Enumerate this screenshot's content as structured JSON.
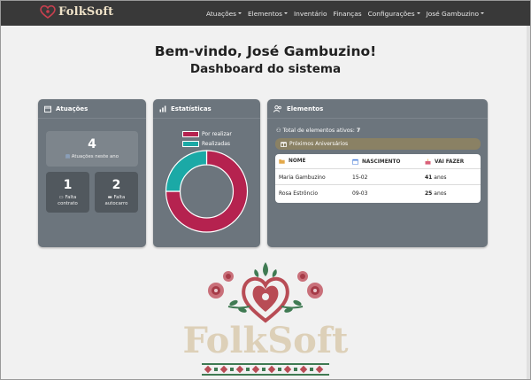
{
  "navbar": {
    "brand": "FolkSoft",
    "items": [
      {
        "label": "Atuações",
        "dropdown": true
      },
      {
        "label": "Elementos",
        "dropdown": true
      },
      {
        "label": "Inventário",
        "dropdown": false
      },
      {
        "label": "Finanças",
        "dropdown": false
      },
      {
        "label": "Configurações",
        "dropdown": true
      },
      {
        "label": "José Gambuzino",
        "dropdown": true
      }
    ]
  },
  "header": {
    "welcome": "Bem-vindo, José Gambuzino!",
    "subtitle": "Dashboard do sistema"
  },
  "atuacoes_card": {
    "title": "Atuações",
    "year_count": "4",
    "year_label": "Atuações neste ano",
    "contract_count": "1",
    "contract_label_1": "Falta",
    "contract_label_2": "contrato",
    "bus_count": "2",
    "bus_label_1": "Falta",
    "bus_label_2": "autocarro"
  },
  "stats_card": {
    "title": "Estatísticas"
  },
  "chart_data": {
    "type": "pie",
    "donut": true,
    "categories": [
      "Por realizar",
      "Realizadas"
    ],
    "values": [
      3,
      1
    ],
    "colors": [
      "#b5224f",
      "#1ba9a6"
    ],
    "legend_position": "top"
  },
  "elements_card": {
    "title": "Elementos",
    "total_label": "Total de elementos ativos:",
    "total_value": "7",
    "upcoming_label": "Próximos Aniversários",
    "columns": {
      "name": "NOME",
      "birth": "NASCIMENTO",
      "turning": "VAI FAZER"
    },
    "rows": [
      {
        "name": "Maria Gambuzino",
        "birth": "15-02",
        "age": "41",
        "unit": "anos"
      },
      {
        "name": "Rosa Estrôncio",
        "birth": "09-03",
        "age": "25",
        "unit": "anos"
      }
    ]
  },
  "logo": {
    "text": "FolkSoft",
    "heart_color": "#b84c55",
    "leaf_color": "#3f7a52",
    "text_color": "#ddd0b8"
  }
}
